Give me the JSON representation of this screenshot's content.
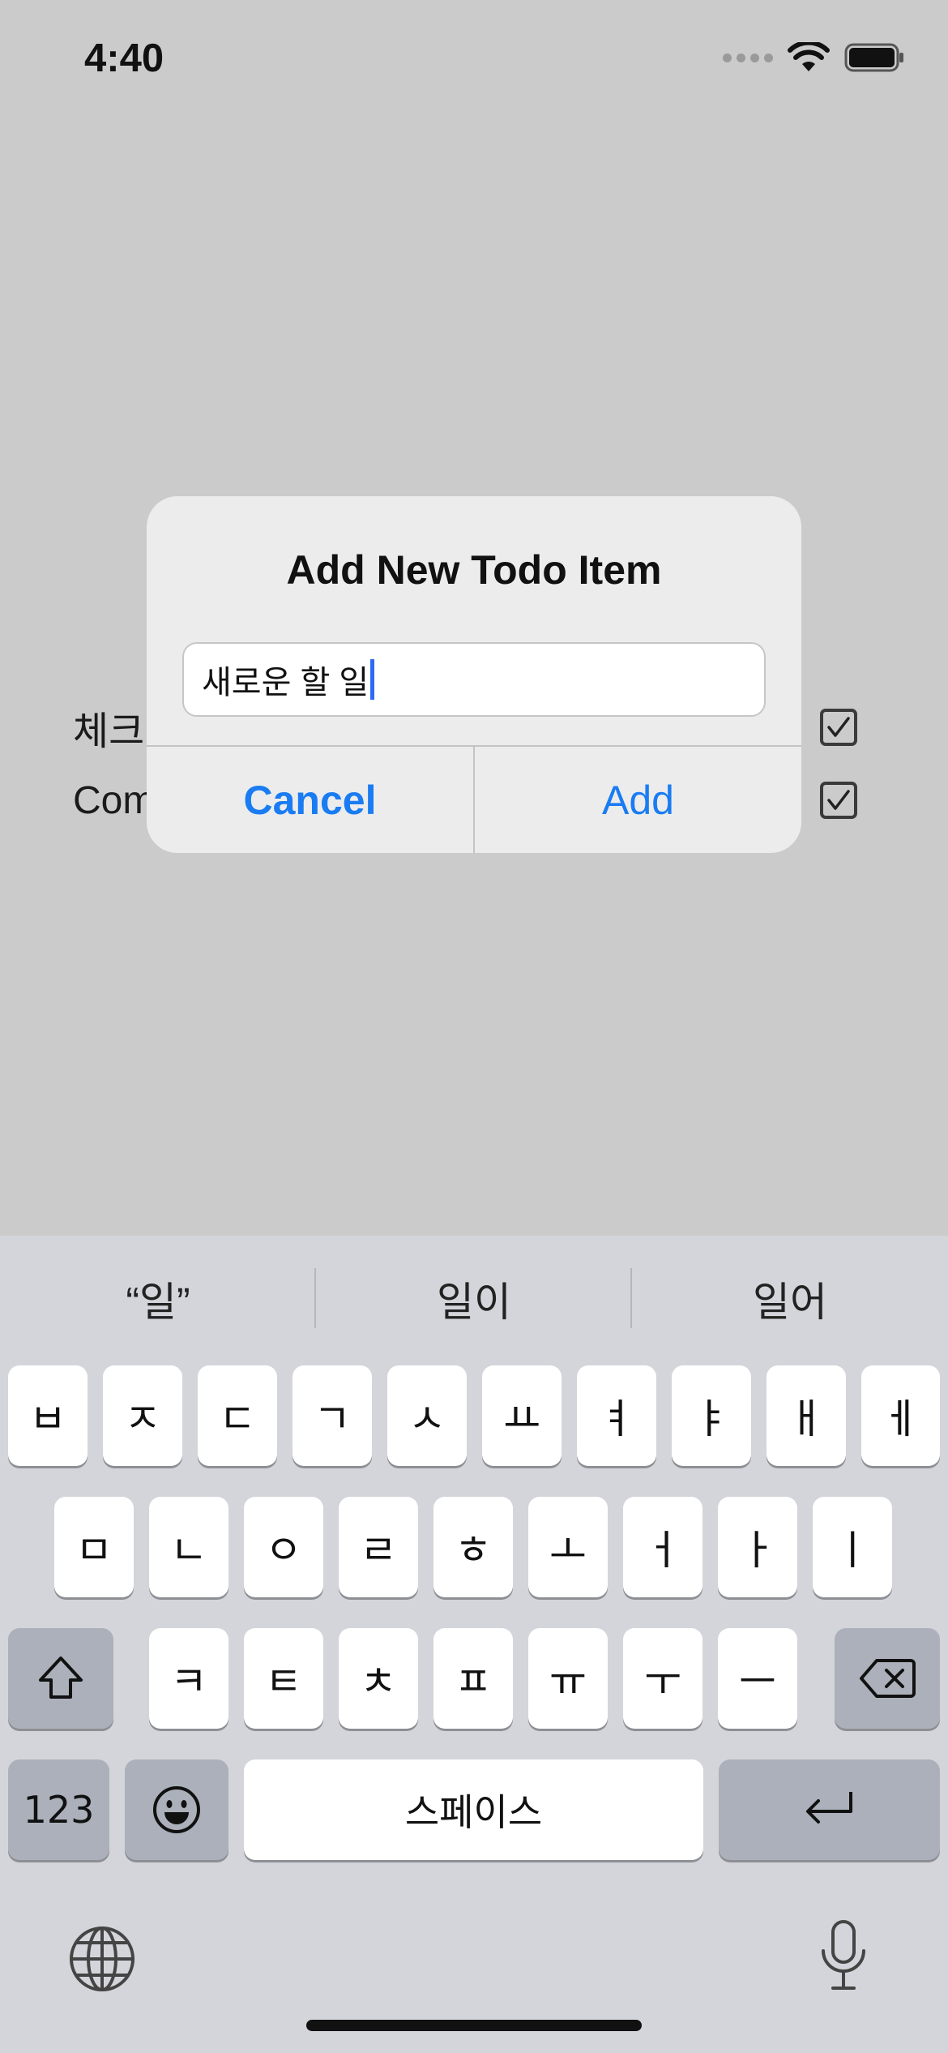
{
  "status_bar": {
    "time": "4:40"
  },
  "list": {
    "items": [
      {
        "label": "체크",
        "checked": true
      },
      {
        "label": "Com",
        "checked": true
      }
    ]
  },
  "alert": {
    "title": "Add New Todo Item",
    "field_value": "새로운 할 일",
    "cancel_label": "Cancel",
    "add_label": "Add"
  },
  "keyboard": {
    "suggestions": [
      "“일”",
      "일이",
      "일어"
    ],
    "row1": [
      "ㅂ",
      "ㅈ",
      "ㄷ",
      "ㄱ",
      "ㅅ",
      "ㅛ",
      "ㅕ",
      "ㅑ",
      "ㅐ",
      "ㅔ"
    ],
    "row2": [
      "ㅁ",
      "ㄴ",
      "ㅇ",
      "ㄹ",
      "ㅎ",
      "ㅗ",
      "ㅓ",
      "ㅏ",
      "ㅣ"
    ],
    "row3": [
      "ㅋ",
      "ㅌ",
      "ㅊ",
      "ㅍ",
      "ㅠ",
      "ㅜ",
      "ㅡ"
    ],
    "numbers_label": "123",
    "space_label": "스페이스"
  },
  "colors": {
    "accent": "#1a7cf2",
    "overlay_background": "#cbcbcb",
    "keyboard_background": "#d4d5da"
  }
}
